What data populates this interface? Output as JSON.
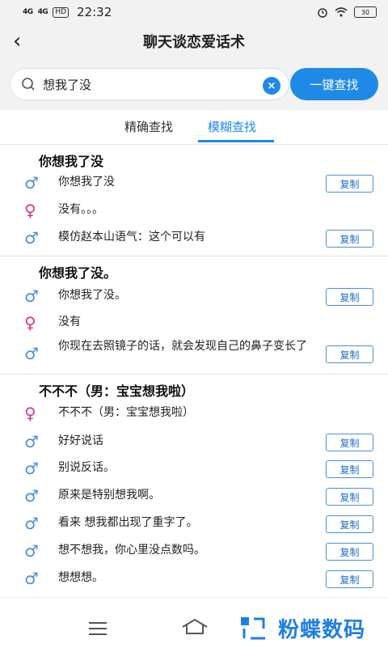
{
  "status": {
    "net1": "4G",
    "net2": "4G",
    "hd": "HD",
    "time": "22:32",
    "battery": "30"
  },
  "header": {
    "title": "聊天谈恋爱话术"
  },
  "search": {
    "value": "想我了没",
    "button": "一键查找",
    "clear": "×"
  },
  "tabs": {
    "exact": "精确查找",
    "fuzzy": "模糊查找"
  },
  "groups": [
    {
      "title": "你想我了没",
      "rows": [
        {
          "gender": "male",
          "text": "你想我了没",
          "copy": "复制"
        },
        {
          "gender": "female",
          "text": "没有。。。"
        },
        {
          "gender": "male",
          "text": "模仿赵本山语气：这个可以有",
          "copy": "复制"
        }
      ]
    },
    {
      "title": "你想我了没。",
      "rows": [
        {
          "gender": "male",
          "text": "你想我了没。",
          "copy": "复制"
        },
        {
          "gender": "female",
          "text": "没有"
        },
        {
          "gender": "male",
          "text": "你现在去照镜子的话，就会发现自己的鼻子变长了",
          "copy": "复制"
        }
      ]
    },
    {
      "title": "不不不（男：宝宝想我啦）",
      "rows": [
        {
          "gender": "female",
          "text": "不不不（男：宝宝想我啦）"
        },
        {
          "gender": "male",
          "text": "好好说话",
          "copy": "复制"
        },
        {
          "gender": "male",
          "text": "别说反话。",
          "copy": "复制"
        },
        {
          "gender": "male",
          "text": "原来是特别想我啊。",
          "copy": "复制"
        },
        {
          "gender": "male",
          "text": "看来 想我都出现了重字了。",
          "copy": "复制"
        },
        {
          "gender": "male",
          "text": "想不想我，你心里没点数吗。",
          "copy": "复制"
        },
        {
          "gender": "male",
          "text": "想想想。",
          "copy": "复制"
        }
      ]
    }
  ],
  "icons": {
    "male": "♂",
    "female": "♀",
    "back": "‹"
  },
  "watermark": {
    "text": "粉蝶数码"
  },
  "colors": {
    "accent": "#1f8ae6",
    "male": "#4a8fd6",
    "female": "#d4358f"
  }
}
